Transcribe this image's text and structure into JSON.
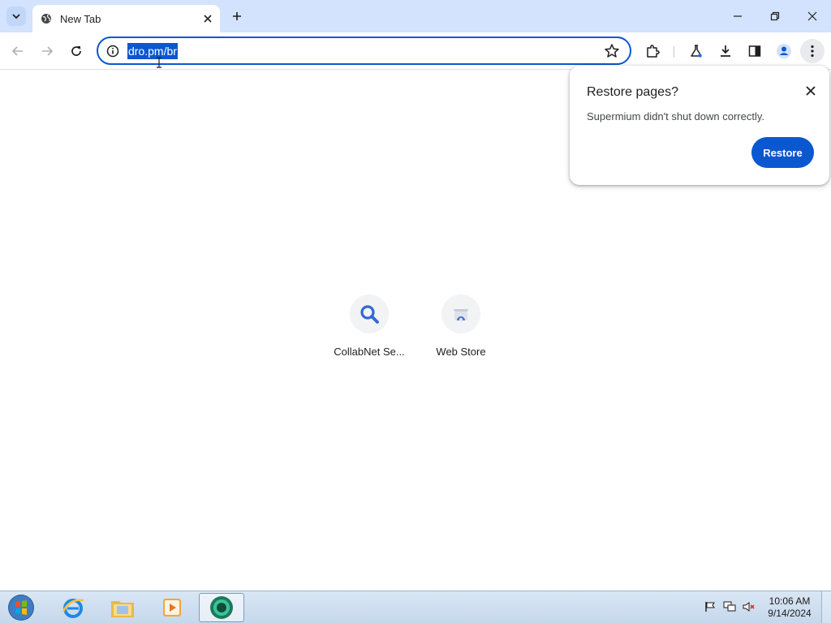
{
  "browser": {
    "tab": {
      "title": "New Tab"
    },
    "omnibox": {
      "url": "dro.pm/br"
    }
  },
  "shortcuts": [
    {
      "label": "CollabNet Se...",
      "icon": "search-icon"
    },
    {
      "label": "Web Store",
      "icon": "web-store-icon"
    }
  ],
  "restore_popup": {
    "title": "Restore pages?",
    "message": "Supermium didn't shut down correctly.",
    "button_label": "Restore"
  },
  "taskbar": {
    "time": "10:06 AM",
    "date": "9/14/2024"
  },
  "colors": {
    "tabstrip": "#d3e3fd",
    "accent": "#0b57d0"
  }
}
